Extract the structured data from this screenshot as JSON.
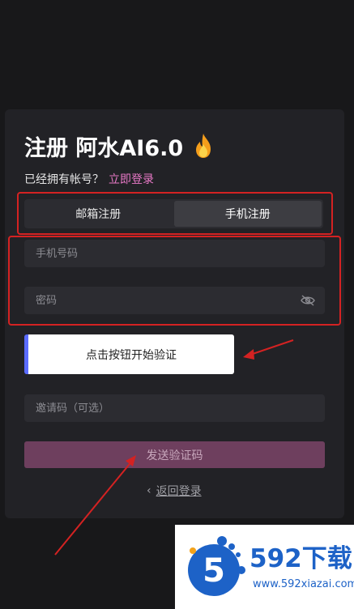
{
  "register": {
    "title": "注册 阿水AI6.0",
    "has_account_text": "已经拥有帐号？",
    "login_link": "立即登录"
  },
  "tabs": [
    {
      "label": "邮箱注册",
      "active": false
    },
    {
      "label": "手机注册",
      "active": true
    }
  ],
  "form": {
    "phone_placeholder": "手机号码",
    "password_placeholder": "密码",
    "captcha_label": "点击按钮开始验证",
    "invite_placeholder": "邀请码（可选）",
    "send_code_label": "发送验证码",
    "back_login_label": "返回登录"
  },
  "watermark": {
    "logo_digit": "5",
    "brand_text": "592下载",
    "url": "www.592xiazai.com"
  },
  "colors": {
    "background": "#18181a",
    "card": "#222226",
    "accent_link": "#e879c7",
    "send_button": "#6e3f5e",
    "annotation_red": "#d42222",
    "watermark_blue": "#1d62c7"
  }
}
